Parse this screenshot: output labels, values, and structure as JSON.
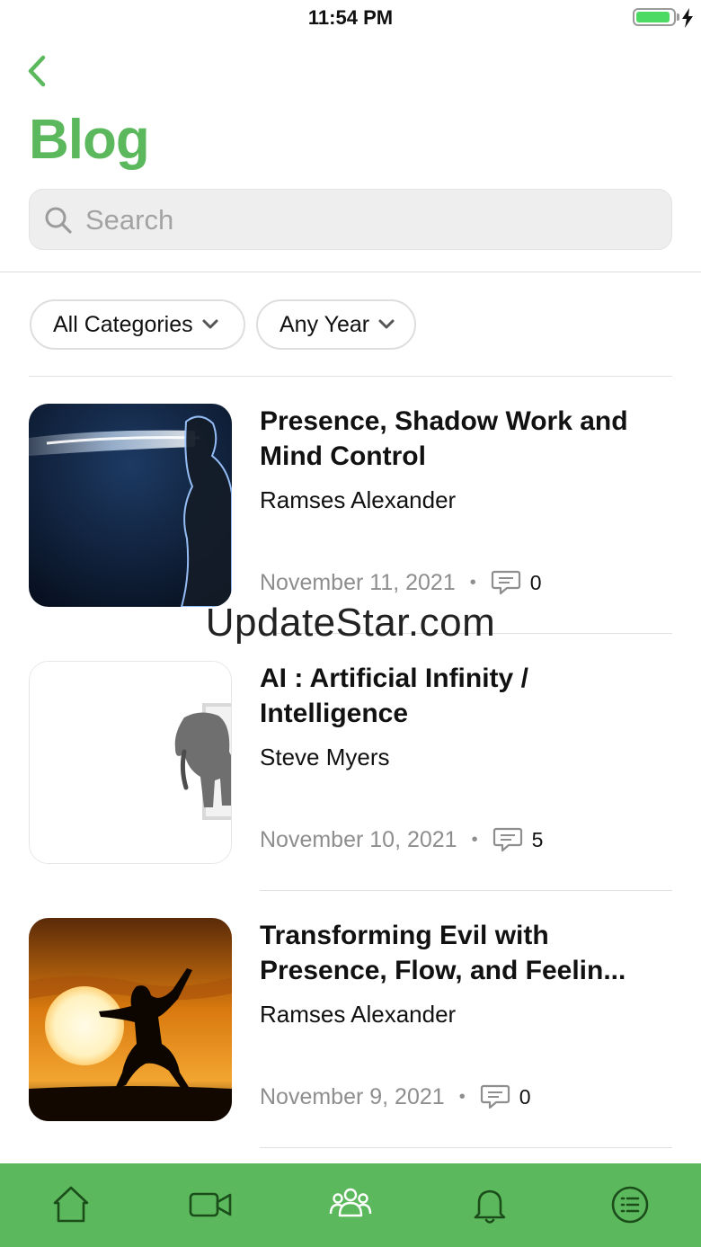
{
  "status_bar": {
    "time": "11:54 PM",
    "battery_level": 0.92
  },
  "header": {
    "title": "Blog",
    "back_icon": "chevron-left-icon"
  },
  "search": {
    "placeholder": "Search",
    "value": "",
    "icon": "search-icon"
  },
  "filters": [
    {
      "label": "All Categories",
      "icon": "chevron-down-icon"
    },
    {
      "label": "Any Year",
      "icon": "chevron-down-icon"
    }
  ],
  "posts": [
    {
      "title_line1": "Presence, Shadow Work and",
      "title_line2": "Mind Control",
      "author": "Ramses Alexander",
      "date": "November 11, 2021",
      "separator": "•",
      "comments": "0",
      "thumbnail": "figure-with-energy-beam-image"
    },
    {
      "title_line1": "AI : Artificial Infinity /",
      "title_line2": "Intelligence",
      "author": "Steve Myers",
      "date": "November 10, 2021",
      "separator": "•",
      "comments": "5",
      "thumbnail": "elephant-in-doorway-image"
    },
    {
      "title_line1": "Transforming Evil with",
      "title_line2": "Presence, Flow, and Feelin...",
      "author": "Ramses Alexander",
      "date": "November 9, 2021",
      "separator": "•",
      "comments": "0",
      "thumbnail": "martial-arts-sunset-image"
    }
  ],
  "watermark": "UpdateStar.com",
  "tab_bar": {
    "items": [
      "home-icon",
      "video-icon",
      "groups-icon",
      "notifications-icon",
      "menu-icon"
    ]
  },
  "colors": {
    "accent": "#5cb85c",
    "tab_bar_bg": "#5cb85c",
    "meta_text": "#8e8e8e",
    "search_bg": "#eeeeee",
    "battery": "#4cd964"
  }
}
